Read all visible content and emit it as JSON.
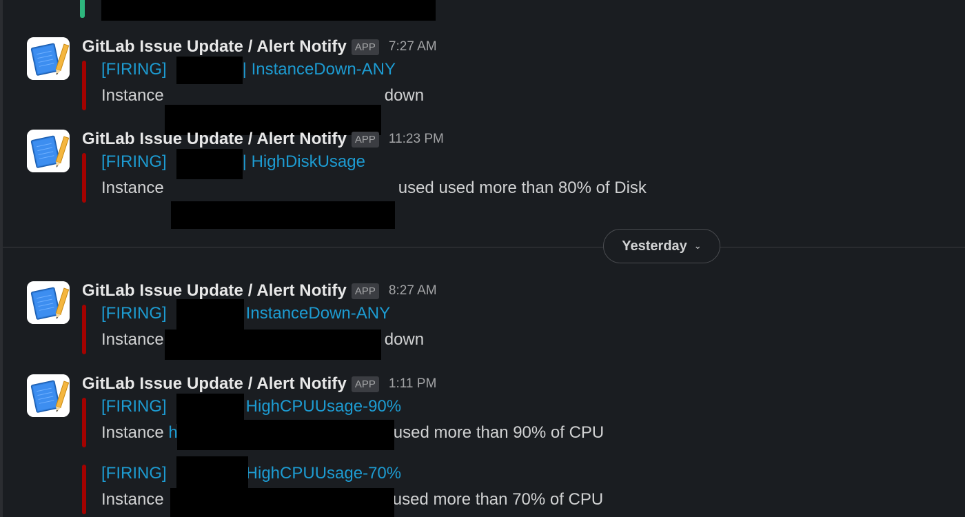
{
  "date_divider": {
    "label": "Yesterday"
  },
  "messages": [
    {
      "sender": "GitLab Issue Update / Alert Notify",
      "badge": "APP",
      "time": "7:27 AM",
      "attachments": [
        {
          "status": "[FIRING]",
          "separator": "|",
          "alert": "InstanceDown-ANY",
          "prefix": "Instance",
          "suffix": "down"
        }
      ]
    },
    {
      "sender": "GitLab Issue Update / Alert Notify",
      "badge": "APP",
      "time": "11:23 PM",
      "attachments": [
        {
          "status": "[FIRING]",
          "separator": "|",
          "alert": "HighDiskUsage",
          "prefix": "Instance",
          "suffix": "used used more than 80% of Disk"
        }
      ]
    },
    {
      "sender": "GitLab Issue Update / Alert Notify",
      "badge": "APP",
      "time": "8:27 AM",
      "attachments": [
        {
          "status": "[FIRING]",
          "alert": "InstanceDown-ANY",
          "prefix": "Instance",
          "suffix": "down"
        }
      ]
    },
    {
      "sender": "GitLab Issue Update / Alert Notify",
      "badge": "APP",
      "time": "1:11 PM",
      "attachments": [
        {
          "status": "[FIRING]",
          "alert": "HighCPUUsage-90%",
          "prefix": "Instance",
          "link_fragment": "h",
          "suffix": "used more than 90% of CPU"
        },
        {
          "status": "[FIRING]",
          "alert": "HighCPUUsage-70%",
          "prefix": "Instance",
          "suffix": "used more than 70% of CPU"
        }
      ]
    }
  ],
  "colors": {
    "background": "#1a1d21",
    "link": "#1d9bd1",
    "alert_bar": "#a30200",
    "top_stub_bar": "#2eb67d"
  },
  "icons": {
    "avatar": "notebook-pencil-icon",
    "divider_toggle": "chevron-down-icon"
  }
}
